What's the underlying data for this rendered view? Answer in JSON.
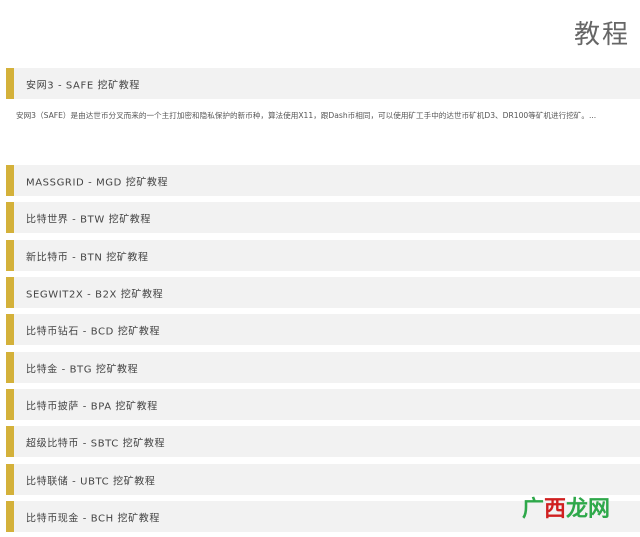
{
  "header": {
    "title": "教程"
  },
  "featured": {
    "label": "安网3 - SAFE 挖矿教程",
    "description": "安网3（SAFE）是由达世币分叉而来的一个主打加密和隐私保护的新币种，算法使用X11，跟Dash币相同，可以使用矿工手中的达世币矿机D3、DR100等矿机进行挖矿。..."
  },
  "list": {
    "items": [
      {
        "label": "MASSGRID - MGD 挖矿教程"
      },
      {
        "label": "比特世界 - BTW 挖矿教程"
      },
      {
        "label": "新比特币 - BTN 挖矿教程"
      },
      {
        "label": "SEGWIT2X - B2X 挖矿教程"
      },
      {
        "label": "比特币钻石 - BCD 挖矿教程"
      },
      {
        "label": "比特金 - BTG 挖矿教程"
      },
      {
        "label": "比特币披萨 - BPA 挖矿教程"
      },
      {
        "label": "超级比特币 - SBTC 挖矿教程"
      },
      {
        "label": "比特联储 - UBTC 挖矿教程"
      },
      {
        "label": "比特币现金 - BCH 挖矿教程"
      }
    ]
  },
  "watermark": {
    "part1": "广",
    "part2": "西",
    "part3": "龙网"
  },
  "colors": {
    "accent": "#d4b13a",
    "item_bg": "#f2f2f2",
    "text": "#444444"
  }
}
